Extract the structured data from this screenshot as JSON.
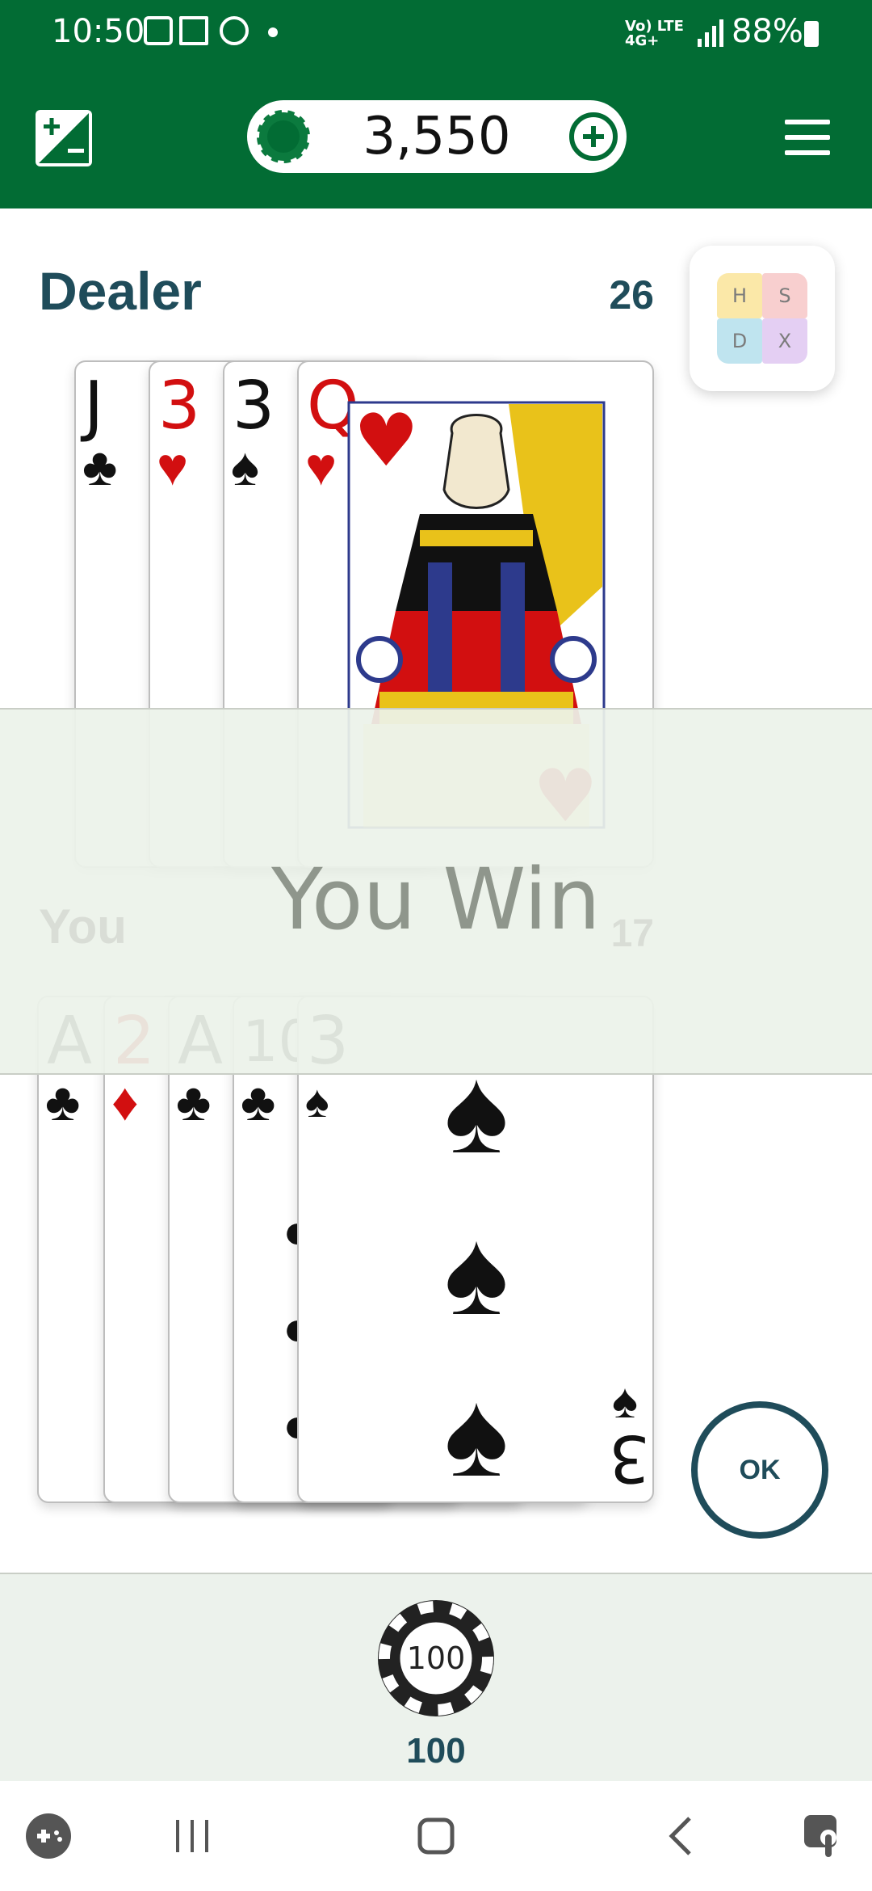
{
  "status_bar": {
    "time": "10:50",
    "network": "Vo) LTE 4G+",
    "battery": "88%"
  },
  "header": {
    "coins": "3,550",
    "calculator_icon": "plus-minus-icon",
    "add_icon": "plus-circle-icon",
    "menu_icon": "hamburger-menu-icon"
  },
  "dealer": {
    "title": "Dealer",
    "score": "26",
    "cards": [
      {
        "rank": "J",
        "suit": "♣",
        "color": "black"
      },
      {
        "rank": "3",
        "suit": "♥",
        "color": "red"
      },
      {
        "rank": "3",
        "suit": "♠",
        "color": "black"
      },
      {
        "rank": "Q",
        "suit": "♥",
        "color": "red"
      }
    ]
  },
  "hint": {
    "h": "H",
    "s": "S",
    "d": "D",
    "x": "X"
  },
  "result": {
    "text": "You Win"
  },
  "player": {
    "title": "You",
    "score": "17",
    "cards": [
      {
        "rank": "A",
        "suit": "♣",
        "color": "black"
      },
      {
        "rank": "2",
        "suit": "♦",
        "color": "red"
      },
      {
        "rank": "A",
        "suit": "♣",
        "color": "black"
      },
      {
        "rank": "10",
        "suit": "♣",
        "color": "black"
      },
      {
        "rank": "3",
        "suit": "♠",
        "color": "black"
      }
    ]
  },
  "actions": {
    "ok_label": "OK"
  },
  "bet": {
    "chip_label": "100",
    "amount": "100"
  },
  "colors": {
    "app_bar": "#026c34",
    "accent": "#1f4c5a",
    "overlay": "#ecf2e9"
  }
}
